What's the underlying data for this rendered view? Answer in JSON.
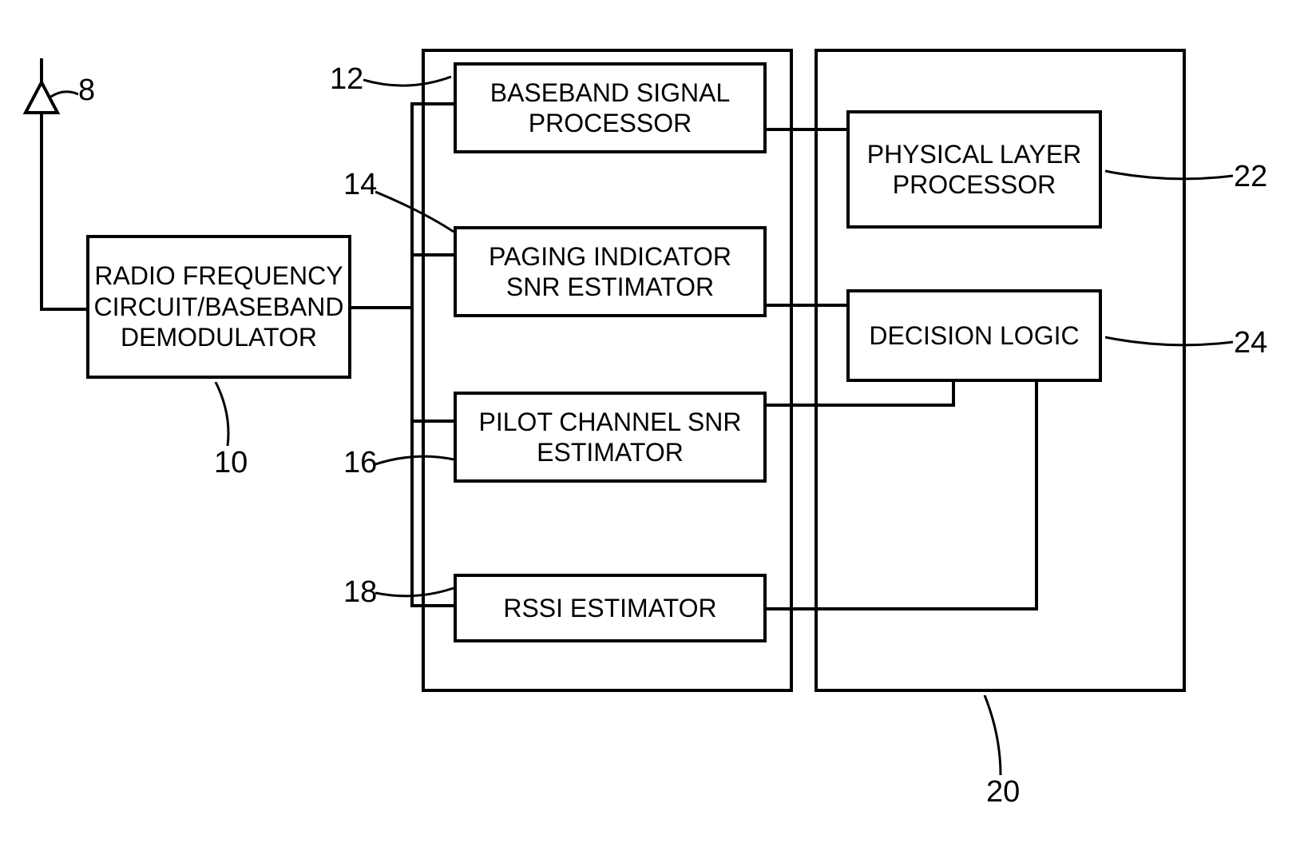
{
  "blocks": {
    "rf_demod": "RADIO FREQUENCY CIRCUIT/BASEBAND DEMODULATOR",
    "baseband_processor": "BASEBAND SIGNAL PROCESSOR",
    "paging_indicator": "PAGING INDICATOR SNR ESTIMATOR",
    "pilot_channel": "PILOT CHANNEL SNR ESTIMATOR",
    "rssi_estimator": "RSSI ESTIMATOR",
    "physical_layer": "PHYSICAL LAYER PROCESSOR",
    "decision_logic": "DECISION LOGIC"
  },
  "labels": {
    "ref_8": "8",
    "ref_10": "10",
    "ref_12": "12",
    "ref_14": "14",
    "ref_16": "16",
    "ref_18": "18",
    "ref_20": "20",
    "ref_22": "22",
    "ref_24": "24"
  }
}
